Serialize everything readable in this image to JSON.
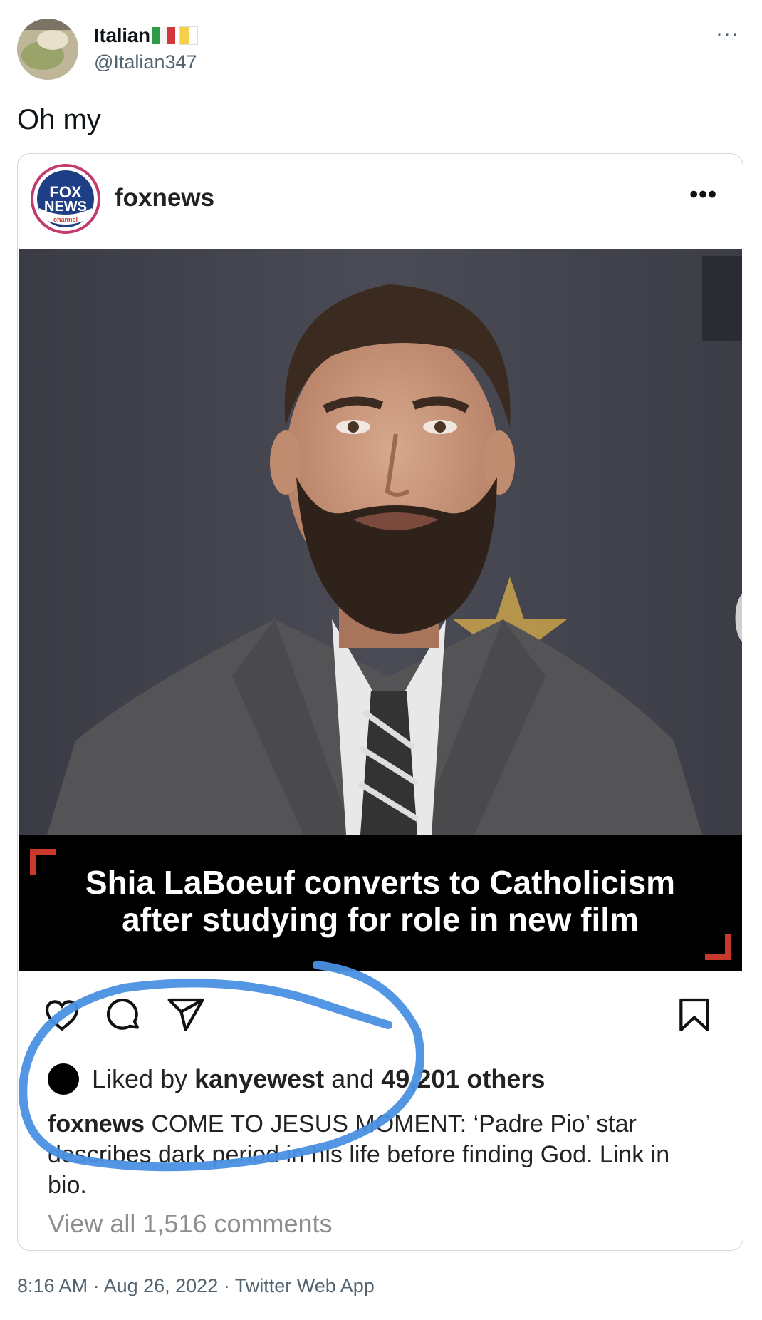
{
  "tweet": {
    "author_name": "Italian",
    "author_handle": "@Italian347",
    "text": "Oh my",
    "more_label": "···",
    "timestamp": "8:16 AM · Aug 26, 2022 · Twitter Web App"
  },
  "embed": {
    "username": "foxnews",
    "more_label": "•••",
    "logo_text_1": "FOX",
    "logo_text_2": "NEWS",
    "logo_text_3": "channel",
    "caption_line_1": "Shia LaBoeuf converts to Catholicism",
    "caption_line_2": "after studying for role in new film",
    "liked_prefix": "Liked by ",
    "liked_user": "kanyewest",
    "liked_suffix": " and ",
    "liked_count": "49,201 others",
    "post_author": "foxnews",
    "post_text": " COME TO JESUS MOMENT: ‘Padre Pio’ star describes dark period in his life before finding God. Link in bio.",
    "comments_link": "View all 1,516 comments"
  },
  "colors": {
    "accent_red": "#c8382c",
    "annotation_blue": "#4a90e2",
    "muted_text": "#536471"
  },
  "icons": [
    "heart-icon",
    "comment-icon",
    "share-icon",
    "bookmark-icon",
    "more-icon"
  ]
}
